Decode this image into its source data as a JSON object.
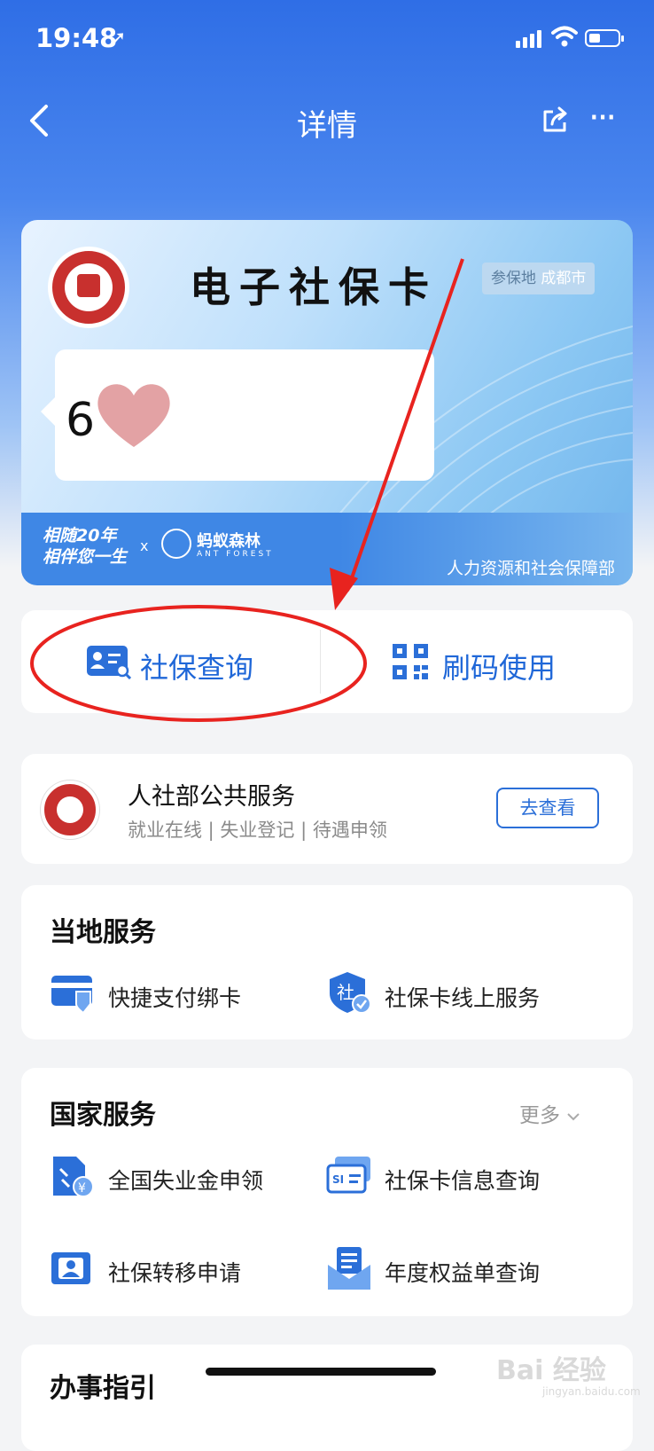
{
  "status_bar": {
    "time": "19:48",
    "location_glyph": "➚"
  },
  "header": {
    "title": "详情",
    "back_icon": "chevron-left-icon",
    "share_icon": "share-icon",
    "more_glyph": "···"
  },
  "card": {
    "title": "电子社保卡",
    "region_label": "参保地",
    "region_value": "成都市",
    "number_visible": "6",
    "slogan_line1": "相随20年",
    "slogan_line2": "相伴您一生",
    "slogan_x": "x",
    "partner": "蚂蚁森林",
    "partner_en": "ANT FOREST",
    "issuer": "人力资源和社会保障部"
  },
  "actions": [
    {
      "label": "社保查询",
      "icon": "id-card-search-icon"
    },
    {
      "label": "刷码使用",
      "icon": "qr-code-icon"
    }
  ],
  "public_service": {
    "title": "人社部公共服务",
    "subtitle": "就业在线 | 失业登记 | 待遇申领",
    "button": "去查看"
  },
  "local_services": {
    "title": "当地服务",
    "items": [
      {
        "label": "快捷支付绑卡",
        "icon": "card-shield-icon"
      },
      {
        "label": "社保卡线上服务",
        "icon": "shield-check-icon"
      }
    ]
  },
  "national_services": {
    "title": "国家服务",
    "more": "更多",
    "items": [
      {
        "label": "全国失业金申领",
        "icon": "unemployment-doc-icon"
      },
      {
        "label": "社保卡信息查询",
        "icon": "si-card-icon"
      },
      {
        "label": "社保转移申请",
        "icon": "person-card-icon"
      },
      {
        "label": "年度权益单查询",
        "icon": "envelope-doc-icon"
      }
    ]
  },
  "guide": {
    "title": "办事指引"
  },
  "watermark": {
    "text": "Bai 经验",
    "sub": "jingyan.baidu.com"
  },
  "colors": {
    "accent": "#2b6fd8",
    "annotation": "#e8231f",
    "badge_red": "#c8302e"
  }
}
